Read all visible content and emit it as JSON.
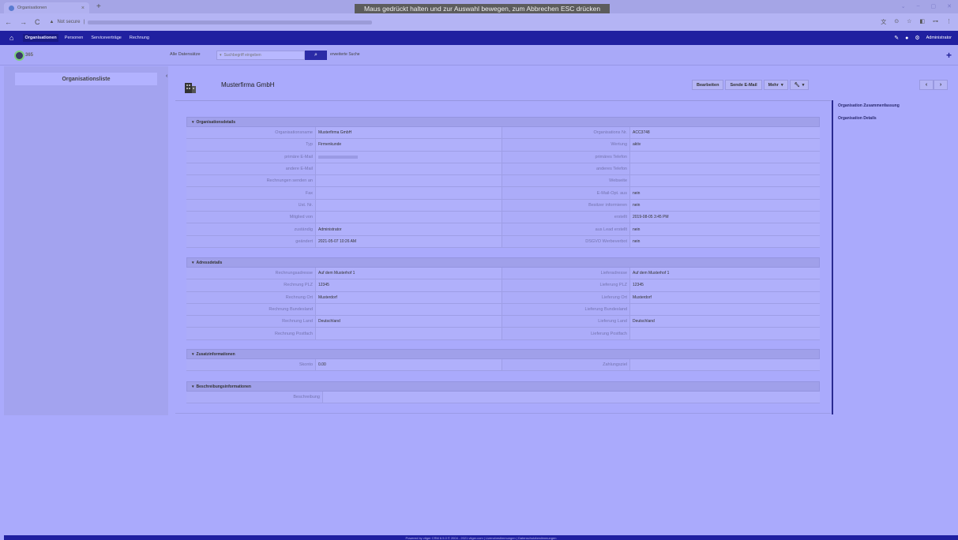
{
  "browser": {
    "tab_title": "Organisationen",
    "address_prefix": "Not secure",
    "overlay_message": "Maus gedrückt halten und zur Auswahl bewegen, zum Abbrechen ESC drücken"
  },
  "appnav": {
    "items": [
      "Organisationen",
      "Personen",
      "Serviceverträge",
      "Rechnung"
    ],
    "user": "Administrator"
  },
  "search": {
    "scope": "Alle Datensätze",
    "placeholder": "Suchbegriff eingeben",
    "advanced": "erweiterte Suche"
  },
  "logo_text": "365",
  "sidebar": {
    "list_item": "Organisationsliste"
  },
  "record": {
    "title": "Musterfirma GmbH",
    "buttons": {
      "edit": "Bearbeiten",
      "email": "Sende E-Mail",
      "more": "Mehr"
    }
  },
  "rightpanel": {
    "items": [
      "Organisation Zusammenfassung",
      "Organisation Details"
    ]
  },
  "blocks": {
    "org": {
      "title": "Organisationsdetails",
      "rows": [
        [
          "Organisationsname",
          "Musterfirma GmbH",
          "Organisations Nr.",
          "ACC3748"
        ],
        [
          "Typ",
          "Firmenkunde",
          "Wertung",
          "aktiv"
        ],
        [
          "primäre E-Mail",
          "",
          "primäres Telefon",
          ""
        ],
        [
          "andere E-Mail",
          "",
          "anderes Telefon",
          ""
        ],
        [
          "Rechnungen senden an",
          "",
          "Webseite",
          ""
        ],
        [
          "Fax",
          "",
          "E-Mail-Opt. aus",
          "nein"
        ],
        [
          "Ust. Nr.",
          "",
          "Besitzer informieren",
          "nein"
        ],
        [
          "Mitglied von",
          "",
          "erstellt",
          "2019-08-05 3:45 PM"
        ],
        [
          "zuständig",
          "Administrator",
          "aus Lead erstellt",
          "nein"
        ],
        [
          "geändert",
          "2021-05-07 10:26 AM",
          "DSGVO Werbeverbot",
          "nein"
        ]
      ]
    },
    "addr": {
      "title": "Adressdetails",
      "rows": [
        [
          "Rechnungsadresse",
          "Auf dem Musterhof 1",
          "Lieferadresse",
          "Auf dem Musterhof 1"
        ],
        [
          "Rechnung PLZ",
          "12345",
          "Lieferung PLZ",
          "12345"
        ],
        [
          "Rechnung Ort",
          "Musterdorf",
          "Lieferung Ort",
          "Musterdorf"
        ],
        [
          "Rechnung Bundesland",
          "",
          "Lieferung Bundesland",
          ""
        ],
        [
          "Rechnung Land",
          "Deutschland",
          "Lieferung Land",
          "Deutschland"
        ],
        [
          "Rechnung Postfach",
          "",
          "Lieferung Postfach",
          ""
        ]
      ]
    },
    "extra": {
      "title": "Zusatzinformationen",
      "rows": [
        [
          "Skonto",
          "0.00",
          "Zahlungsziel",
          ""
        ]
      ]
    },
    "desc": {
      "title": "Beschreibungsinformationen",
      "label": "Beschreibung",
      "value": ""
    }
  },
  "footer": "Powered by vtiger CRM 6.5.0 © 2004 - 2021 vtiger.com | Lizenzbestimmungen | Datenschutzbestimmungen"
}
